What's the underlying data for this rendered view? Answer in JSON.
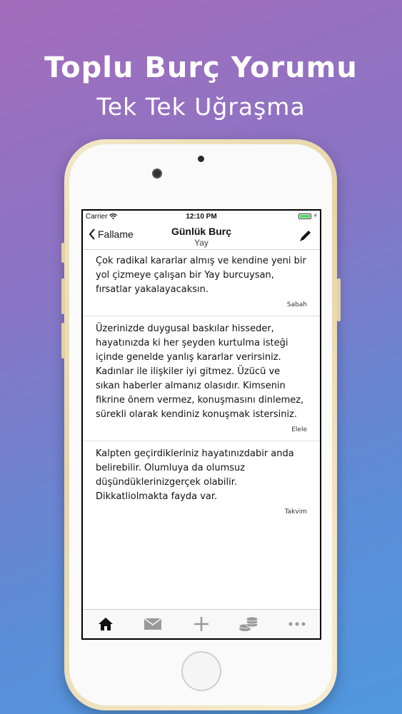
{
  "promo": {
    "title": "Toplu Burç Yorumu",
    "subtitle": "Tek Tek Uğraşma"
  },
  "statusbar": {
    "carrier": "Carrier",
    "time": "12:10 PM"
  },
  "navbar": {
    "back_label": "Fallame",
    "title": "Günlük Burç",
    "subtitle": "Yay"
  },
  "entries": [
    {
      "text": "Çok radikal kararlar almış ve kendine yeni bir yol çizmeye çalışan bir Yay burcuysan, fırsatlar yakalayacaksın.",
      "source": "Sabah"
    },
    {
      "text": "Üzerinizde duygusal baskılar hisseder, hayatınızda ki her şeyden kurtulma isteği içinde genelde yanlış kararlar verirsiniz. Kadınlar ile ilişkiler iyi gitmez. Üzücü ve sıkan haberler almanız olasıdır. Kimsenin fikrine önem vermez, konuşmasını dinlemez, sürekli olarak kendiniz konuşmak istersiniz.",
      "source": "Elele"
    },
    {
      "text": "Kalpten geçirdikleriniz hayatınızdabir anda belirebilir. Olumluya da olumsuz düşündüklerinizgerçek olabilir. Dikkatliolmakta fayda var.",
      "source": "Takvim"
    }
  ],
  "tabbar": {
    "items": [
      "home-icon",
      "mail-icon",
      "plus-icon",
      "coins-icon",
      "more-icon"
    ]
  },
  "colors": {
    "battery": "#4cd964",
    "tab_active": "#111111",
    "tab_inactive": "#9a9a9a"
  }
}
